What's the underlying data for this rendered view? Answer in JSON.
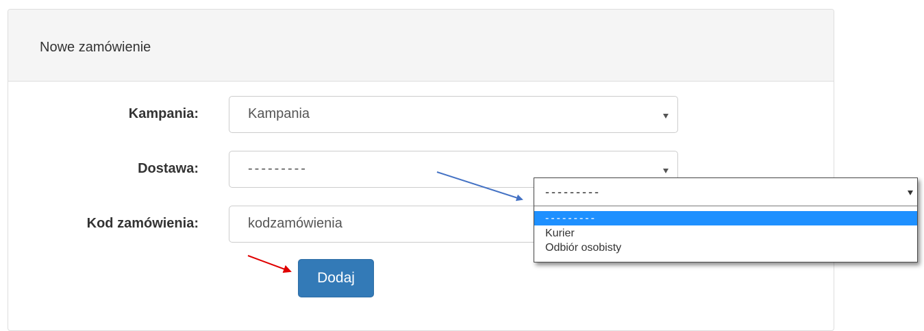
{
  "panel": {
    "title": "Nowe zamówienie"
  },
  "form": {
    "campaign": {
      "label": "Kampania:",
      "value": "Kampania"
    },
    "delivery": {
      "label": "Dostawa:",
      "value": "---------"
    },
    "order_code": {
      "label": "Kod zamówienia:",
      "value": "kodzamówienia"
    },
    "submit_label": "Dodaj"
  },
  "delivery_dropdown": {
    "selected_value": "---------",
    "options": [
      {
        "label": "---------",
        "highlighted": true
      },
      {
        "label": "Kurier",
        "highlighted": false
      },
      {
        "label": "Odbiór osobisty",
        "highlighted": false
      }
    ]
  },
  "annotations": [
    {
      "name": "blue-arrow",
      "color": "#4472c4"
    },
    {
      "name": "red-arrow",
      "color": "#e00000"
    }
  ],
  "colors": {
    "primary_button": "#337ab7",
    "option_highlight": "#1e90ff",
    "panel_heading_bg": "#f5f5f5"
  }
}
